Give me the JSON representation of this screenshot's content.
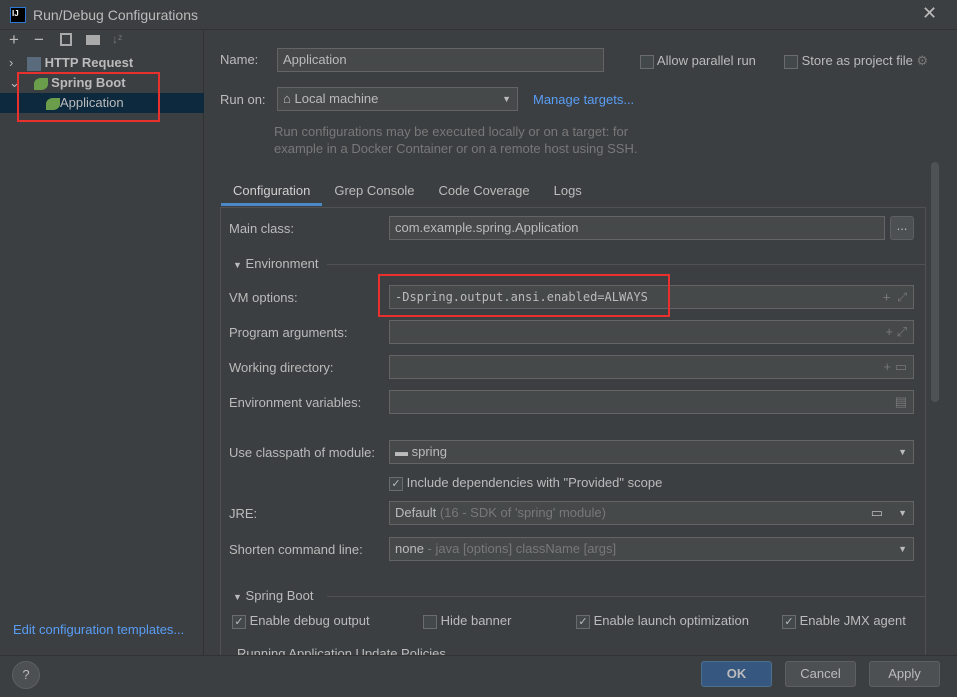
{
  "window": {
    "title": "Run/Debug Configurations",
    "logo": "IJ"
  },
  "toolbar": {
    "icons": [
      "add-icon",
      "remove-icon",
      "copy-icon",
      "folder-add-icon",
      "sort-icon"
    ]
  },
  "tree": {
    "items": [
      {
        "label": "HTTP Request",
        "expanded": false
      },
      {
        "label": "Spring Boot",
        "expanded": true
      },
      {
        "label": "Application",
        "selected": true
      }
    ]
  },
  "edit_templates": "Edit configuration templates...",
  "name_label": "Name:",
  "name_value": "Application",
  "allow_parallel": "Allow parallel run",
  "store_project": "Store as project file",
  "run_on_label": "Run on:",
  "run_on_value": "Local machine",
  "manage_targets": "Manage targets...",
  "run_on_hint": [
    "Run configurations may be executed locally or on a target: for",
    "example in a Docker Container or on a remote host using SSH."
  ],
  "tabs": [
    "Configuration",
    "Grep Console",
    "Code Coverage",
    "Logs"
  ],
  "main_class_label": "Main class:",
  "main_class_value": "com.example.spring.Application",
  "browse": "...",
  "environment": "Environment",
  "vm_label": "VM options:",
  "vm_value": "-Dspring.output.ansi.enabled=ALWAYS",
  "prog_args_label": "Program arguments:",
  "workdir_label": "Working directory:",
  "envvars_label": "Environment variables:",
  "classpath_label": "Use classpath of module:",
  "classpath_value": "spring",
  "include_deps": "Include dependencies with \"Provided\" scope",
  "jre_label": "JRE:",
  "jre_value": "Default",
  "jre_hint": "(16 - SDK of 'spring' module)",
  "shorten_label": "Shorten command line:",
  "shorten_value": "none",
  "shorten_hint": "- java [options] className [args]",
  "spring_boot_section": "Spring Boot",
  "checks": [
    {
      "label": "Enable debug output",
      "checked": true
    },
    {
      "label": "Hide banner",
      "checked": false
    },
    {
      "label": "Enable launch optimization",
      "checked": true
    },
    {
      "label": "Enable JMX agent",
      "checked": true
    }
  ],
  "cut_section": "Running Application Update Policies",
  "buttons": {
    "ok": "OK",
    "cancel": "Cancel",
    "apply": "Apply",
    "help": "?"
  },
  "colors": {
    "accent": "#365880",
    "highlight": "#e8312f",
    "link": "#589df6"
  }
}
